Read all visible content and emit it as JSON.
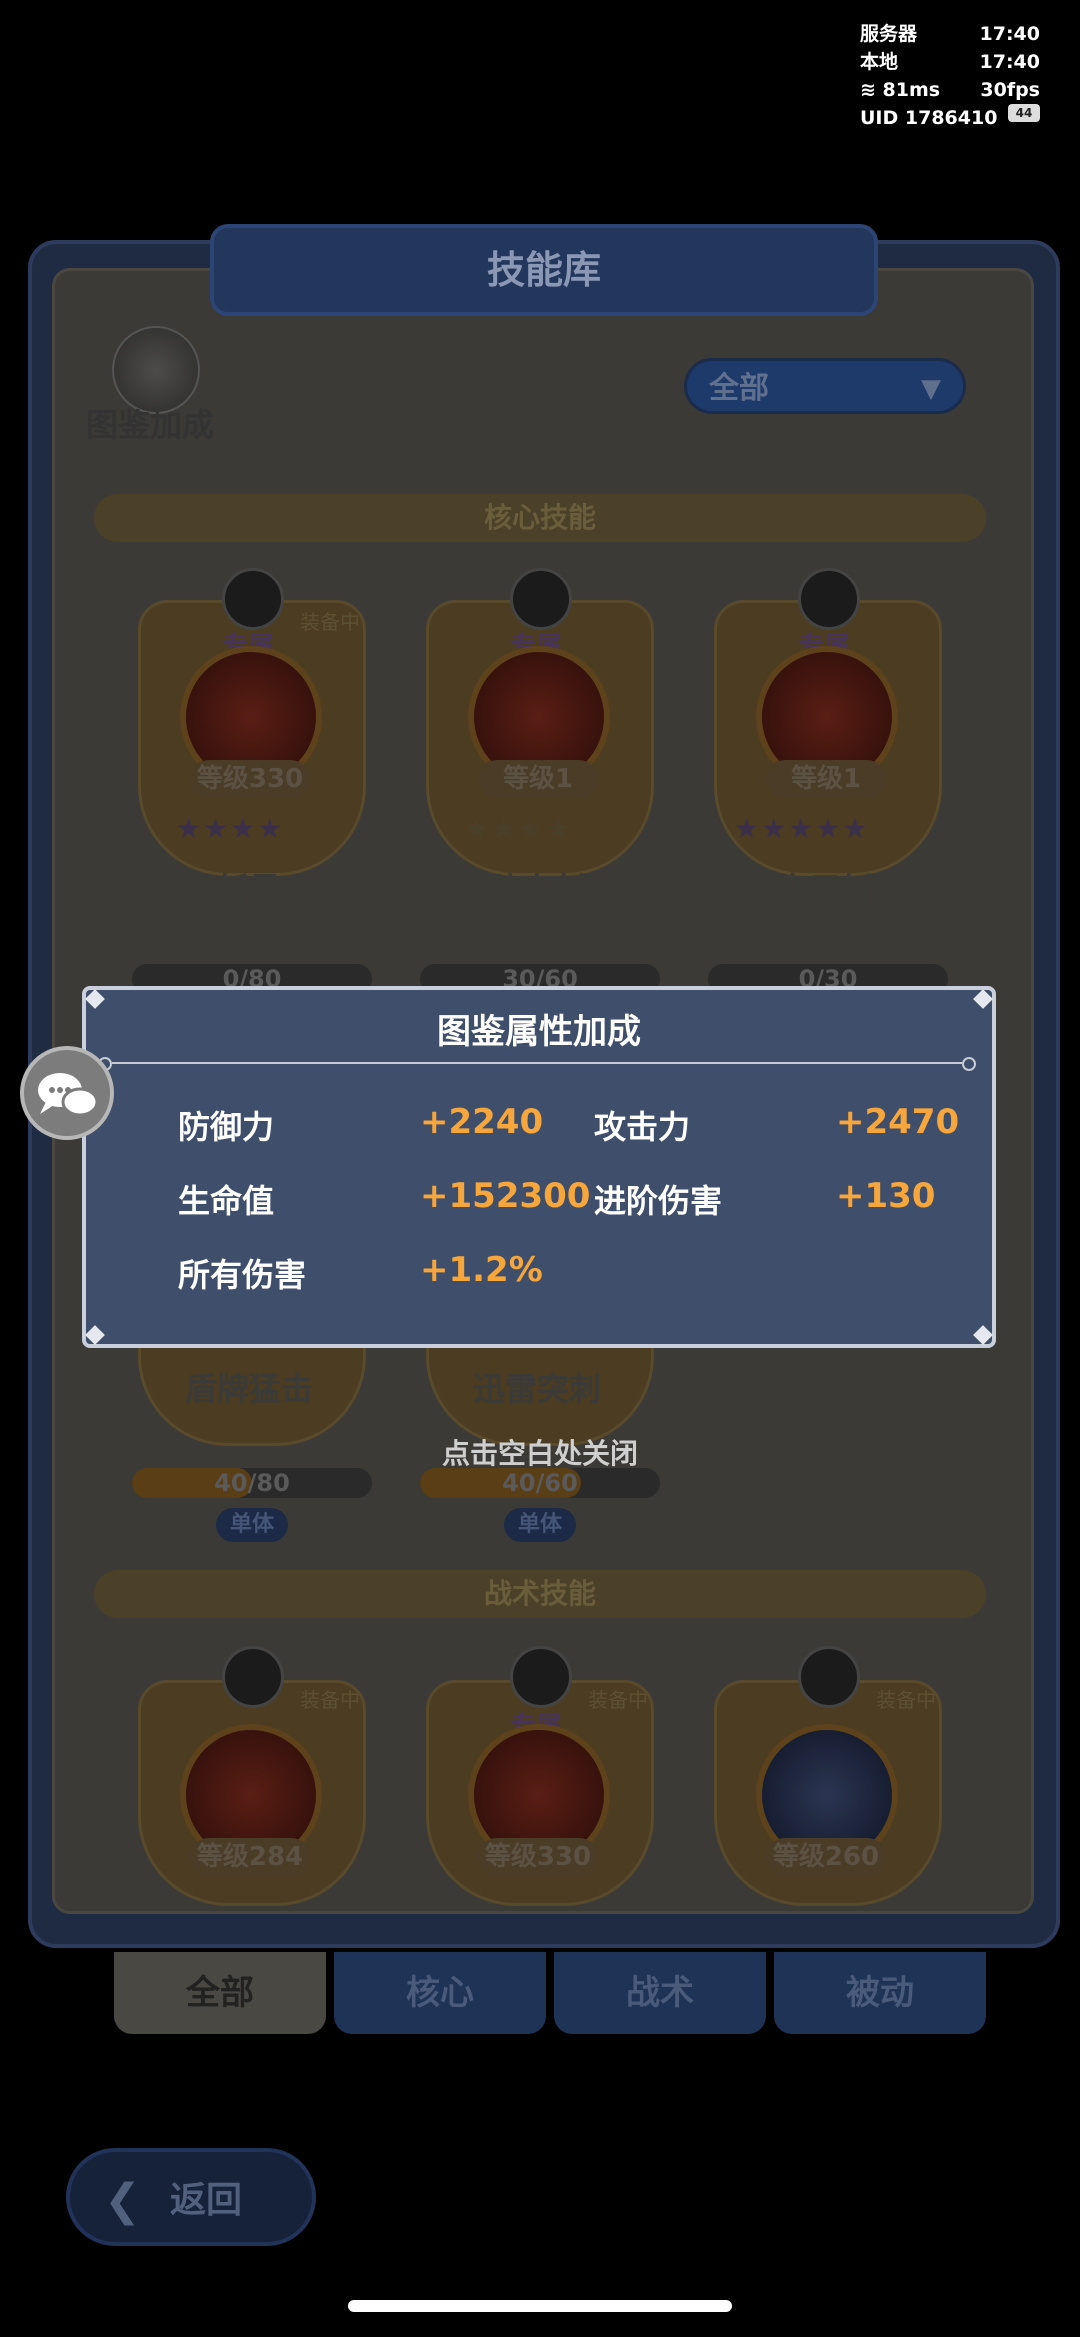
{
  "status": {
    "server_label": "服务器",
    "server_time": "17:40",
    "local_label": "本地",
    "local_time": "17:40",
    "ping": "81ms",
    "fps": "30fps",
    "uid": "UID  1786410",
    "battery": "44"
  },
  "panel": {
    "title": "技能库",
    "codex_label": "图鉴加成",
    "filter_value": "全部"
  },
  "sections": {
    "core": "核心技能",
    "tactical": "战术技能"
  },
  "core_cards": [
    {
      "badge": "专属",
      "equip": "装备中",
      "level": "等级330",
      "stars": "★★★★",
      "name": "斩星"
    },
    {
      "badge": "专属",
      "equip": "",
      "level": "等级1",
      "stars": "★★★★",
      "name": "碎火剑"
    },
    {
      "badge": "专属",
      "equip": "",
      "level": "等级1",
      "stars": "★★★★★",
      "name": "次元斩"
    }
  ],
  "core_progress_partial": [
    "0/80",
    "30/60",
    "0/30"
  ],
  "row2_cards": [
    {
      "name": "盾牌猛击",
      "progress": "40/80",
      "progress_fraction": 0.5,
      "target": "单体"
    },
    {
      "name": "迅雷突刺",
      "progress": "40/60",
      "progress_fraction": 0.67,
      "target": "单体"
    }
  ],
  "tactical_cards": [
    {
      "equip": "装备中",
      "badge": "",
      "level": "等级284"
    },
    {
      "equip": "装备中",
      "badge": "专属",
      "level": "等级330"
    },
    {
      "equip": "装备中",
      "badge": "",
      "level": "等级260"
    }
  ],
  "tabs": [
    {
      "label": "全部",
      "active": true
    },
    {
      "label": "核心",
      "active": false
    },
    {
      "label": "战术",
      "active": false
    },
    {
      "label": "被动",
      "active": false
    }
  ],
  "back_label": "返回",
  "popup": {
    "title": "图鉴属性加成",
    "stats": [
      {
        "label": "防御力",
        "value": "+2240"
      },
      {
        "label": "攻击力",
        "value": "+2470"
      },
      {
        "label": "生命值",
        "value": "+152300"
      },
      {
        "label": "进阶伤害",
        "value": "+130"
      },
      {
        "label": "所有伤害",
        "value": "+1.2%"
      }
    ]
  },
  "close_hint": "点击空白处关闭",
  "colors": {
    "stat_value": "#f7a63c",
    "popup_bg": "#3e4e6b"
  }
}
